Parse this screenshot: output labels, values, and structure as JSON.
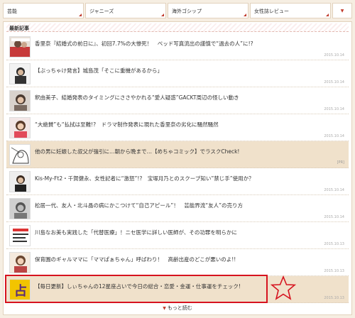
{
  "nav": {
    "tabs": [
      "芸能",
      "ジャニーズ",
      "海外ゴシップ",
      "女性誌レビュー"
    ],
    "more_icon": "▼"
  },
  "section": {
    "title": "最新記事"
  },
  "articles": [
    {
      "title": "香里奈『結婚式の前日に』、初回7.7%の大惨死！　ベッド写真流出の謹慎で“過去の人”に!?",
      "date": "2015.10.14"
    },
    {
      "title": "【ぶっちゃけ発言】城島茂「そこに重機があるから」",
      "date": "2015.10.14"
    },
    {
      "title": "釈由美子、結婚発表のタイミングにささやかれる“愛人疑惑”GACKT周辺の怪しい動き",
      "date": "2015.10.14"
    },
    {
      "title": "“大絶賛”も“払拭は至難!?　ドラマ制作発表に現れた香里奈の劣化に騒然騒然",
      "date": "2015.10.14"
    },
    {
      "title": "他の男に妊娠した叔父が強引に…朝から晩まで…【めちゃコミック】でラスクCheck!",
      "pr": "[PR]"
    },
    {
      "title": "Kis-My-Ft2・千賀健永、女性記者に“激怒”!?　宝塚月乃とのスクープ知い”禁じ手”使用か？",
      "date": "2015.10.14"
    },
    {
      "title": "松居一代、友人・北斗晶の病にかこつけて“自己アピール”！　芸能界流“友人”の売り方",
      "date": "2015.10.14"
    },
    {
      "title": "川島なお美も実践した「代替医療」！ニセ医学に詳しい医師が、その功罪を明らかに",
      "date": "2015.10.13"
    },
    {
      "title": "保育園のギャルママに「ママぱぁちゃん」呼ばわり！　高齢出産のどこが悪いのよ!!",
      "date": "2015.10.13"
    },
    {
      "title": "【毎日更新】しぃちゃんの12星座占いで今日の総合・恋愛・金運・仕事運をチェック!",
      "date": "2015.10.13"
    }
  ],
  "more": {
    "label": "もっと読む"
  },
  "colors": {
    "accent": "#c0392b",
    "highlight": "#d6131f",
    "background": "#f6eee2",
    "ad_row": "#f0e1cb"
  }
}
